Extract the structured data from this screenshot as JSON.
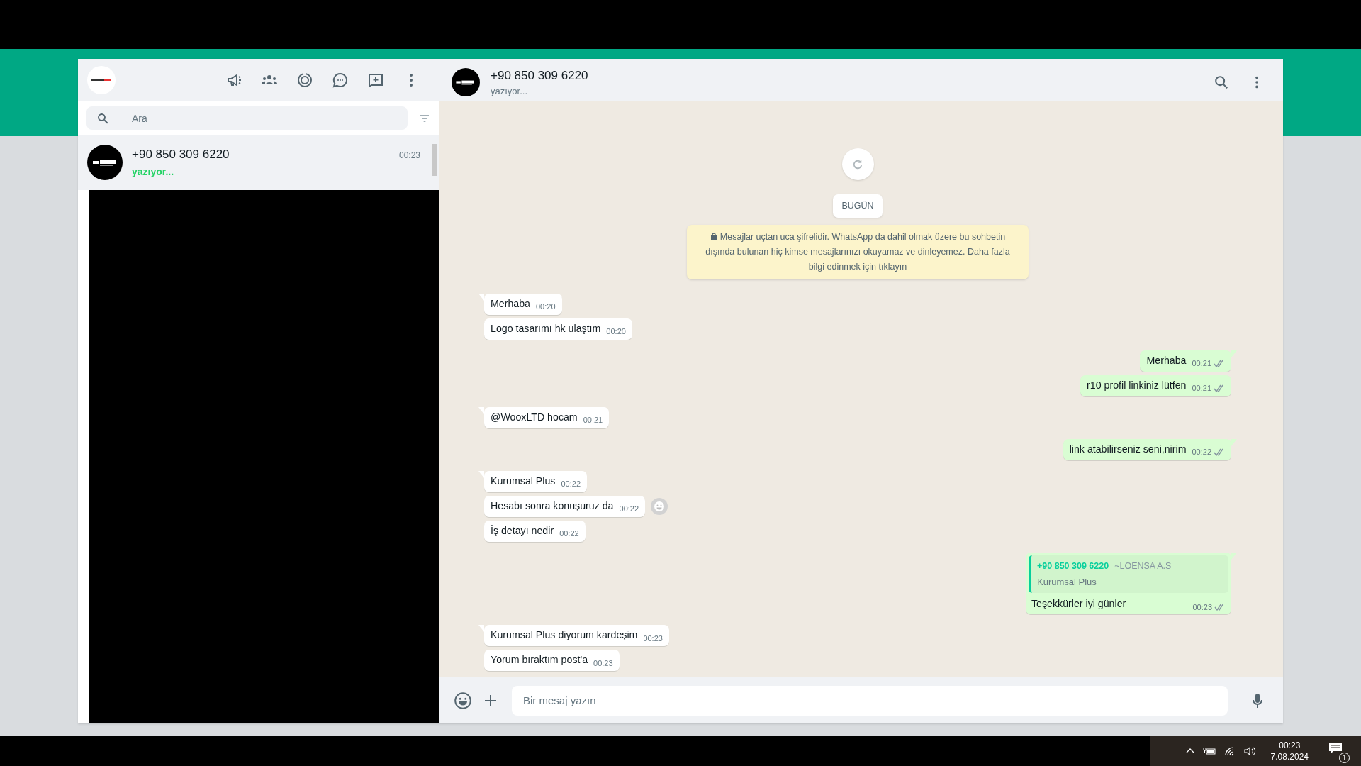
{
  "sidebar": {
    "search": {
      "placeholder": "Ara"
    },
    "chats": [
      {
        "name": "+90 850 309 6220",
        "preview": "yazıyor...",
        "time": "00:23",
        "selected": true
      }
    ]
  },
  "chat": {
    "title": "+90 850 309 6220",
    "status": "yazıyor...",
    "date_label": "BUGÜN",
    "notice": "Mesajlar uçtan uca şifrelidir. WhatsApp da dahil olmak üzere bu sohbetin dışında bulunan hiç kimse mesajlarınızı okuyamaz ve dinleyemez. Daha fazla bilgi edinmek için tıklayın",
    "message_groups": [
      {
        "kind": "incoming",
        "messages": [
          {
            "text": "Merhaba",
            "time": "00:20"
          },
          {
            "text": "Logo tasarımı hk ulaştım",
            "time": "00:20"
          }
        ]
      },
      {
        "kind": "outgoing",
        "messages": [
          {
            "text": "Merhaba",
            "time": "00:21",
            "read": false
          },
          {
            "text": "r10 profil linkiniz lütfen",
            "time": "00:21",
            "read": false
          }
        ]
      },
      {
        "kind": "incoming",
        "messages": [
          {
            "text": "@WooxLTD hocam",
            "time": "00:21"
          }
        ]
      },
      {
        "kind": "outgoing",
        "messages": [
          {
            "text": "link atabilirseniz seni,nirim",
            "time": "00:22",
            "read": false
          }
        ]
      },
      {
        "kind": "incoming",
        "messages": [
          {
            "text": "Kurumsal Plus",
            "time": "00:22"
          },
          {
            "text": "Hesabı sonra konuşuruz da",
            "time": "00:22",
            "reaction_button": true
          },
          {
            "text": "İş detayı nedir",
            "time": "00:22"
          }
        ]
      },
      {
        "kind": "outgoing",
        "messages": [
          {
            "text": "Teşekkürler iyi günler",
            "time": "00:23",
            "read": false,
            "quote": {
              "author": "+90 850 309 6220",
              "author_note": "~LOENSA A.S",
              "text": "Kurumsal Plus"
            }
          }
        ]
      },
      {
        "kind": "incoming",
        "messages": [
          {
            "text": "Kurumsal Plus diyorum kardeşim",
            "time": "00:23"
          },
          {
            "text": "Yorum bıraktım post'a",
            "time": "00:23"
          }
        ]
      }
    ],
    "composer": {
      "placeholder": "Bir mesaj yazın"
    }
  },
  "taskbar": {
    "time": "00:23",
    "date": "7.08.2024",
    "notification_count": "1"
  }
}
